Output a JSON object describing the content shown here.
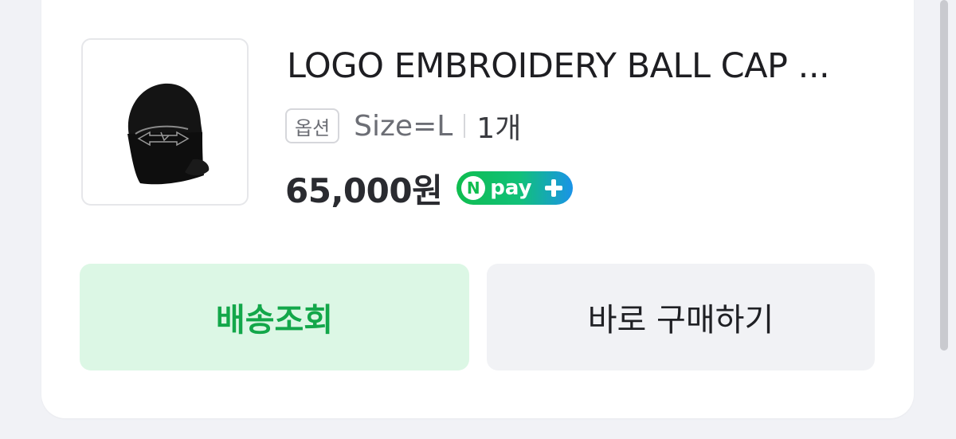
{
  "product": {
    "title": "LOGO EMBROIDERY BALL CAP ...",
    "option_badge": "옵션",
    "option_value": "Size=L",
    "quantity": "1개",
    "price": "65,000원",
    "npay_label": "pay"
  },
  "actions": {
    "track_delivery": "배송조회",
    "buy_now": "바로 구매하기"
  },
  "colors": {
    "accent_green": "#13a74a",
    "track_button_bg": "#dcf7e5",
    "buy_button_bg": "#f1f2f5",
    "page_bg": "#f1f2f6"
  },
  "icons": [
    "ball-cap-thumbnail",
    "npay-logo"
  ]
}
